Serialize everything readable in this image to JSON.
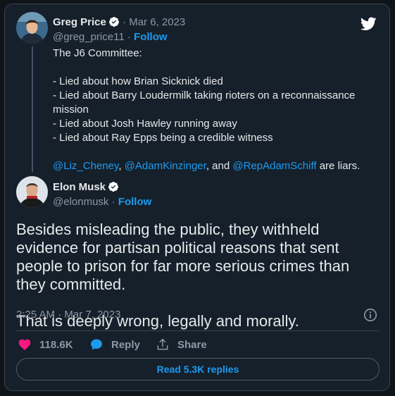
{
  "quoted_tweet": {
    "author_name": "Greg Price",
    "date": "· Mar 6, 2023",
    "handle": "@greg_price11",
    "separator": "·",
    "follow_label": "Follow",
    "lines": [
      "The J6 Committee:",
      "",
      "- Lied about how Brian Sicknick died",
      "- Lied about Barry Loudermilk taking rioters on a reconnaissance mission",
      "- Lied about Josh Hawley running away",
      "- Lied about Ray Epps being a credible witness",
      ""
    ],
    "mentions": {
      "m1": "@Liz_Cheney",
      "sep1": ",",
      "m2": "@AdamKinzinger",
      "sep2": ", and",
      "m3": "@RepAdamSchiff",
      "tail": "are liars."
    }
  },
  "main_tweet": {
    "author_name": "Elon Musk",
    "handle": "@elonmusk",
    "separator": "·",
    "follow_label": "Follow",
    "paragraph1": "Besides misleading the public, they withheld evidence for partisan political reasons that sent people to prison for far more serious crimes than they committed.",
    "paragraph2": "That is deeply wrong, legally and morally.",
    "timestamp": "2:25 AM · Mar 7, 2023"
  },
  "actions": {
    "likes": "118.6K",
    "reply_label": "Reply",
    "share_label": "Share"
  },
  "read_replies_label": "Read 5.3K replies",
  "icons": {
    "brand": "twitter-bird-icon",
    "verified": "verified-badge-icon",
    "info": "info-icon",
    "like": "heart-icon",
    "reply": "reply-bubble-icon",
    "share": "share-icon"
  },
  "colors": {
    "background": "#15202b",
    "accent": "#1d9bf0",
    "like": "#f91880",
    "text": "#e7e9ea",
    "muted": "#8b98a5"
  }
}
